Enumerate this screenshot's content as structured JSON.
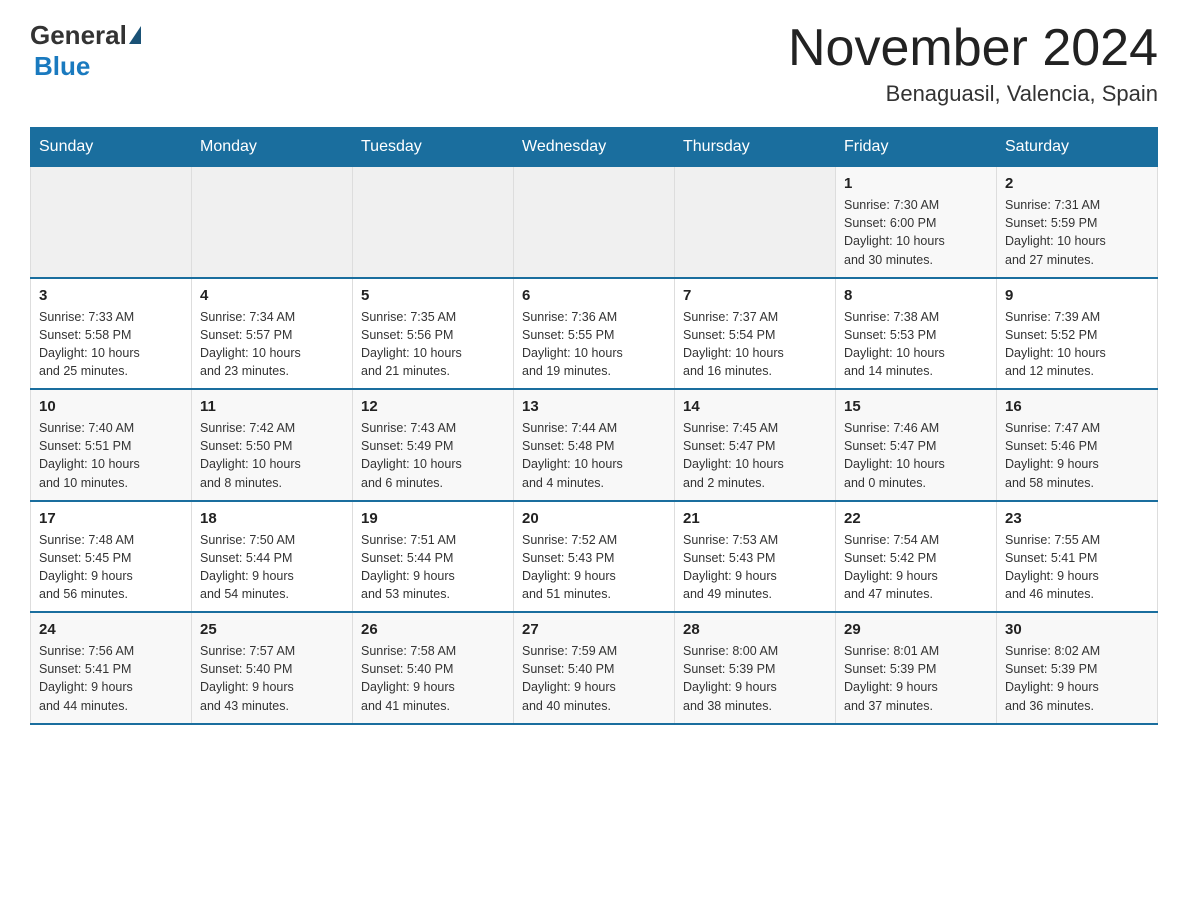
{
  "header": {
    "logo_general": "General",
    "logo_blue": "Blue",
    "month_year": "November 2024",
    "location": "Benaguasil, Valencia, Spain"
  },
  "weekdays": [
    "Sunday",
    "Monday",
    "Tuesday",
    "Wednesday",
    "Thursday",
    "Friday",
    "Saturday"
  ],
  "weeks": [
    [
      {
        "day": "",
        "info": ""
      },
      {
        "day": "",
        "info": ""
      },
      {
        "day": "",
        "info": ""
      },
      {
        "day": "",
        "info": ""
      },
      {
        "day": "",
        "info": ""
      },
      {
        "day": "1",
        "info": "Sunrise: 7:30 AM\nSunset: 6:00 PM\nDaylight: 10 hours\nand 30 minutes."
      },
      {
        "day": "2",
        "info": "Sunrise: 7:31 AM\nSunset: 5:59 PM\nDaylight: 10 hours\nand 27 minutes."
      }
    ],
    [
      {
        "day": "3",
        "info": "Sunrise: 7:33 AM\nSunset: 5:58 PM\nDaylight: 10 hours\nand 25 minutes."
      },
      {
        "day": "4",
        "info": "Sunrise: 7:34 AM\nSunset: 5:57 PM\nDaylight: 10 hours\nand 23 minutes."
      },
      {
        "day": "5",
        "info": "Sunrise: 7:35 AM\nSunset: 5:56 PM\nDaylight: 10 hours\nand 21 minutes."
      },
      {
        "day": "6",
        "info": "Sunrise: 7:36 AM\nSunset: 5:55 PM\nDaylight: 10 hours\nand 19 minutes."
      },
      {
        "day": "7",
        "info": "Sunrise: 7:37 AM\nSunset: 5:54 PM\nDaylight: 10 hours\nand 16 minutes."
      },
      {
        "day": "8",
        "info": "Sunrise: 7:38 AM\nSunset: 5:53 PM\nDaylight: 10 hours\nand 14 minutes."
      },
      {
        "day": "9",
        "info": "Sunrise: 7:39 AM\nSunset: 5:52 PM\nDaylight: 10 hours\nand 12 minutes."
      }
    ],
    [
      {
        "day": "10",
        "info": "Sunrise: 7:40 AM\nSunset: 5:51 PM\nDaylight: 10 hours\nand 10 minutes."
      },
      {
        "day": "11",
        "info": "Sunrise: 7:42 AM\nSunset: 5:50 PM\nDaylight: 10 hours\nand 8 minutes."
      },
      {
        "day": "12",
        "info": "Sunrise: 7:43 AM\nSunset: 5:49 PM\nDaylight: 10 hours\nand 6 minutes."
      },
      {
        "day": "13",
        "info": "Sunrise: 7:44 AM\nSunset: 5:48 PM\nDaylight: 10 hours\nand 4 minutes."
      },
      {
        "day": "14",
        "info": "Sunrise: 7:45 AM\nSunset: 5:47 PM\nDaylight: 10 hours\nand 2 minutes."
      },
      {
        "day": "15",
        "info": "Sunrise: 7:46 AM\nSunset: 5:47 PM\nDaylight: 10 hours\nand 0 minutes."
      },
      {
        "day": "16",
        "info": "Sunrise: 7:47 AM\nSunset: 5:46 PM\nDaylight: 9 hours\nand 58 minutes."
      }
    ],
    [
      {
        "day": "17",
        "info": "Sunrise: 7:48 AM\nSunset: 5:45 PM\nDaylight: 9 hours\nand 56 minutes."
      },
      {
        "day": "18",
        "info": "Sunrise: 7:50 AM\nSunset: 5:44 PM\nDaylight: 9 hours\nand 54 minutes."
      },
      {
        "day": "19",
        "info": "Sunrise: 7:51 AM\nSunset: 5:44 PM\nDaylight: 9 hours\nand 53 minutes."
      },
      {
        "day": "20",
        "info": "Sunrise: 7:52 AM\nSunset: 5:43 PM\nDaylight: 9 hours\nand 51 minutes."
      },
      {
        "day": "21",
        "info": "Sunrise: 7:53 AM\nSunset: 5:43 PM\nDaylight: 9 hours\nand 49 minutes."
      },
      {
        "day": "22",
        "info": "Sunrise: 7:54 AM\nSunset: 5:42 PM\nDaylight: 9 hours\nand 47 minutes."
      },
      {
        "day": "23",
        "info": "Sunrise: 7:55 AM\nSunset: 5:41 PM\nDaylight: 9 hours\nand 46 minutes."
      }
    ],
    [
      {
        "day": "24",
        "info": "Sunrise: 7:56 AM\nSunset: 5:41 PM\nDaylight: 9 hours\nand 44 minutes."
      },
      {
        "day": "25",
        "info": "Sunrise: 7:57 AM\nSunset: 5:40 PM\nDaylight: 9 hours\nand 43 minutes."
      },
      {
        "day": "26",
        "info": "Sunrise: 7:58 AM\nSunset: 5:40 PM\nDaylight: 9 hours\nand 41 minutes."
      },
      {
        "day": "27",
        "info": "Sunrise: 7:59 AM\nSunset: 5:40 PM\nDaylight: 9 hours\nand 40 minutes."
      },
      {
        "day": "28",
        "info": "Sunrise: 8:00 AM\nSunset: 5:39 PM\nDaylight: 9 hours\nand 38 minutes."
      },
      {
        "day": "29",
        "info": "Sunrise: 8:01 AM\nSunset: 5:39 PM\nDaylight: 9 hours\nand 37 minutes."
      },
      {
        "day": "30",
        "info": "Sunrise: 8:02 AM\nSunset: 5:39 PM\nDaylight: 9 hours\nand 36 minutes."
      }
    ]
  ]
}
